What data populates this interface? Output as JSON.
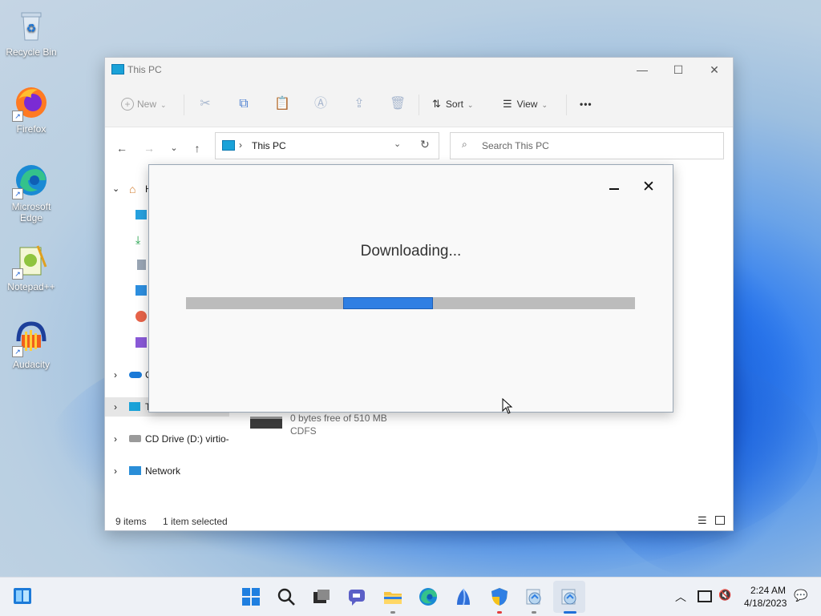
{
  "desktop": {
    "icons": [
      {
        "label": "Recycle Bin",
        "icon": "recycle-bin-icon"
      },
      {
        "label": "Firefox",
        "icon": "firefox-icon"
      },
      {
        "label": "Microsoft Edge",
        "icon": "edge-icon"
      },
      {
        "label": "Notepad++",
        "icon": "notepadpp-icon"
      },
      {
        "label": "Audacity",
        "icon": "audacity-icon"
      }
    ]
  },
  "explorer": {
    "title": "This PC",
    "toolbar": {
      "new_label": "New",
      "sort_label": "Sort",
      "view_label": "View",
      "more_label": "•••"
    },
    "address": {
      "path": "This PC"
    },
    "search": {
      "placeholder": "Search This PC"
    },
    "sidebar": {
      "home_letter": "H",
      "onedrive_letter": "O",
      "thispc_letter": "T",
      "cd_drive": "CD Drive (D:) virtio-",
      "network": "Network"
    },
    "drive": {
      "free_text": "0 bytes free of 510 MB",
      "fs": "CDFS"
    },
    "status": {
      "items": "9 items",
      "selected": "1 item selected"
    }
  },
  "dialog": {
    "title": "Downloading...",
    "progress": {
      "start": 0.35,
      "end": 0.55
    }
  },
  "taskbar": {
    "time": "2:24 AM",
    "date": "4/18/2023"
  },
  "colors": {
    "accent": "#2f7fe3",
    "track": "#bcbcbc"
  }
}
